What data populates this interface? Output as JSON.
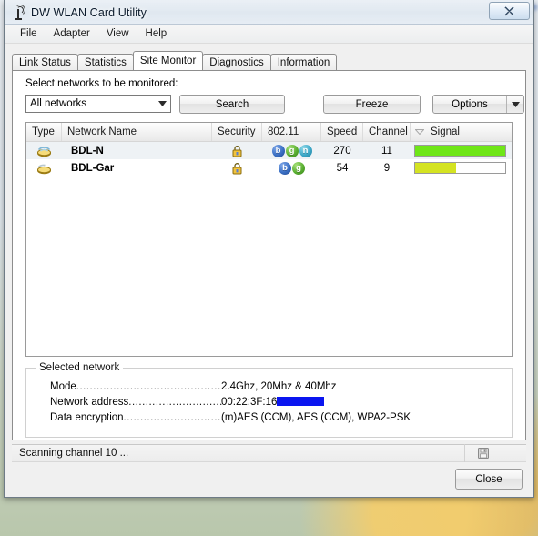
{
  "window": {
    "title": "DW WLAN Card Utility",
    "app_icon": "wireless-signal-icon",
    "close_button": "close-icon"
  },
  "menubar": {
    "items": [
      {
        "label": "File"
      },
      {
        "label": "Adapter"
      },
      {
        "label": "View"
      },
      {
        "label": "Help"
      }
    ]
  },
  "tabs": [
    {
      "label": "Link Status",
      "active": false
    },
    {
      "label": "Statistics",
      "active": false
    },
    {
      "label": "Site Monitor",
      "active": true
    },
    {
      "label": "Diagnostics",
      "active": false
    },
    {
      "label": "Information",
      "active": false
    }
  ],
  "toolbar": {
    "select_label": "Select networks to be monitored:",
    "network_filter_value": "All networks",
    "network_filter_arrow": "chevron-down-icon",
    "search_label": "Search",
    "freeze_label": "Freeze",
    "options_label": "Options",
    "options_arrow": "chevron-down-icon"
  },
  "list": {
    "columns": [
      {
        "label": "Type"
      },
      {
        "label": "Network Name"
      },
      {
        "label": "Security"
      },
      {
        "label": "802.11"
      },
      {
        "label": "Speed"
      },
      {
        "label": "Channel"
      },
      {
        "label": "Signal"
      }
    ],
    "sort": {
      "column": "Signal",
      "direction": "descending",
      "icon": "sort-descending-icon"
    },
    "rows": [
      {
        "type_icon": "access-point-icon",
        "name": "BDL-N",
        "security_icon": "lock-icon",
        "standards": [
          "b",
          "g",
          "n"
        ],
        "speed": "270",
        "channel": "11",
        "signal_percent": 100,
        "signal_color": "#6ee617",
        "selected": true
      },
      {
        "type_icon": "access-point-icon",
        "name": "BDL-Gar",
        "security_icon": "lock-icon",
        "standards": [
          "b",
          "g"
        ],
        "speed": "54",
        "channel": "9",
        "signal_percent": 45,
        "signal_color": "#d4e322",
        "selected": false
      }
    ]
  },
  "selected_network": {
    "legend": "Selected network",
    "fields": [
      {
        "key": "Mode",
        "dots": "..............................................",
        "value": "2.4Ghz, 20Mhz & 40Mhz",
        "redacted": false
      },
      {
        "key": "Network address",
        "dots": "............................",
        "value": "00:22:3F:16",
        "redacted": true
      },
      {
        "key": "Data encryption",
        "dots": "..............................",
        "value": "(m)AES (CCM), AES (CCM), WPA2-PSK",
        "redacted": false
      }
    ]
  },
  "statusbar": {
    "text": "Scanning channel 10 ...",
    "save_icon": "floppy-disk-save-icon"
  },
  "footer": {
    "close_label": "Close"
  }
}
